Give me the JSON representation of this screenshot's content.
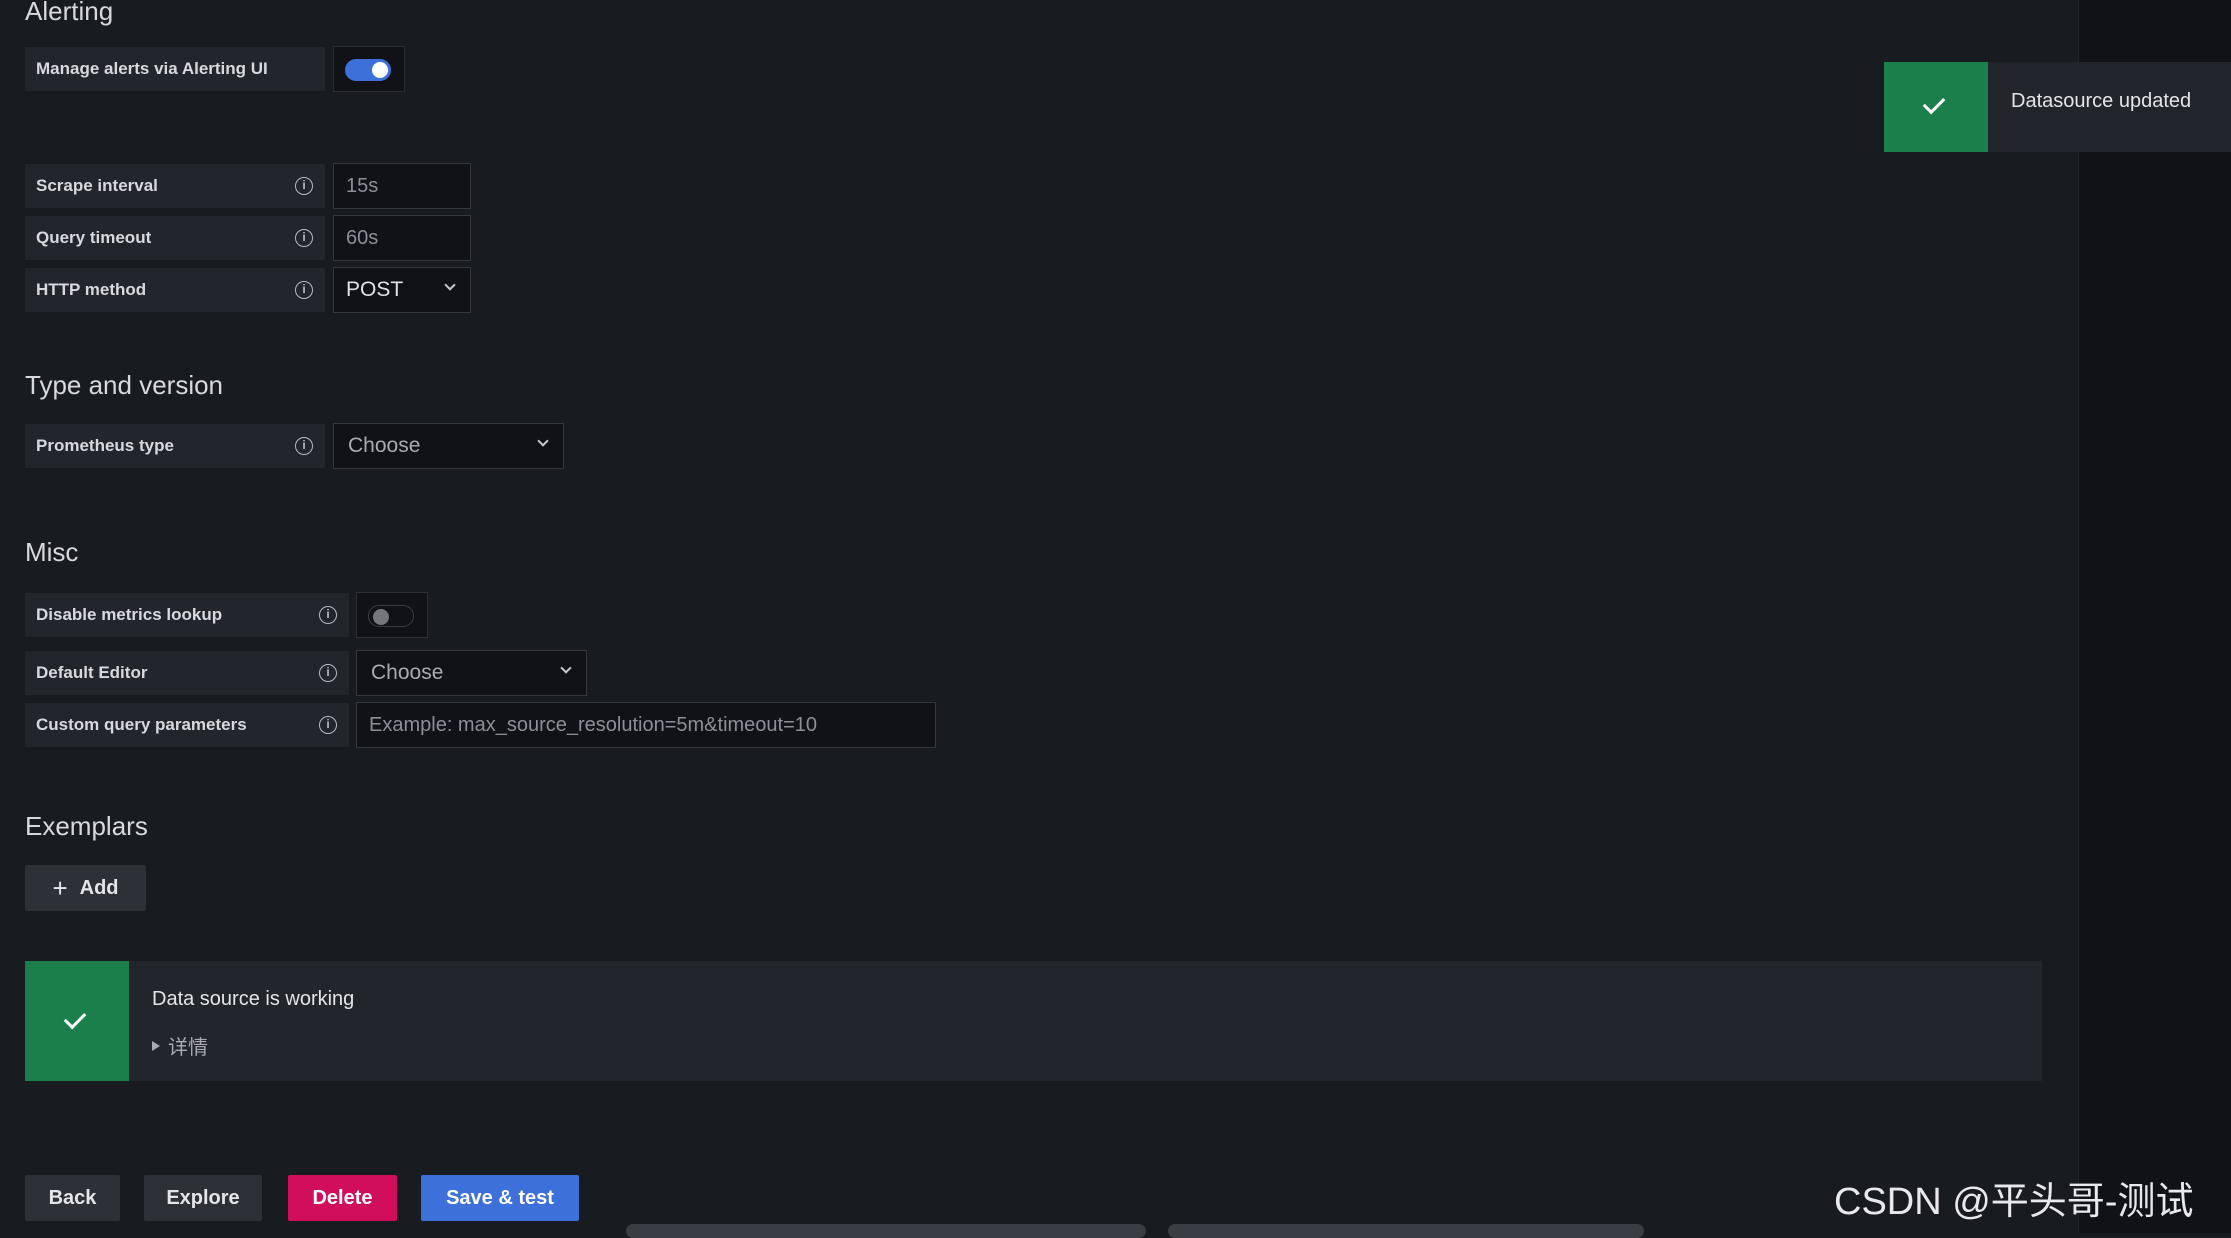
{
  "alerting": {
    "title": "Alerting",
    "manage_alerts_label": "Manage alerts via Alerting UI",
    "manage_alerts_enabled": true
  },
  "http": {
    "scrape_interval_label": "Scrape interval",
    "scrape_interval_placeholder": "15s",
    "query_timeout_label": "Query timeout",
    "query_timeout_placeholder": "60s",
    "http_method_label": "HTTP method",
    "http_method_value": "POST"
  },
  "type_version": {
    "title": "Type and version",
    "prometheus_type_label": "Prometheus type",
    "prometheus_type_value": "Choose"
  },
  "misc": {
    "title": "Misc",
    "disable_metrics_lookup_label": "Disable metrics lookup",
    "disable_metrics_lookup_enabled": false,
    "default_editor_label": "Default Editor",
    "default_editor_value": "Choose",
    "custom_query_params_label": "Custom query parameters",
    "custom_query_params_placeholder": "Example: max_source_resolution=5m&timeout=10"
  },
  "exemplars": {
    "title": "Exemplars",
    "add_label": "Add"
  },
  "status_alert": {
    "title": "Data source is working",
    "details_label": "详情"
  },
  "toast": {
    "message": "Datasource updated"
  },
  "actions": {
    "back": "Back",
    "explore": "Explore",
    "delete": "Delete",
    "save_test": "Save & test"
  },
  "watermark": "CSDN @平头哥-测试",
  "colors": {
    "background": "#181b1f",
    "success": "#1a7f4b",
    "primary": "#3d71d9",
    "danger": "#d10e5c"
  }
}
